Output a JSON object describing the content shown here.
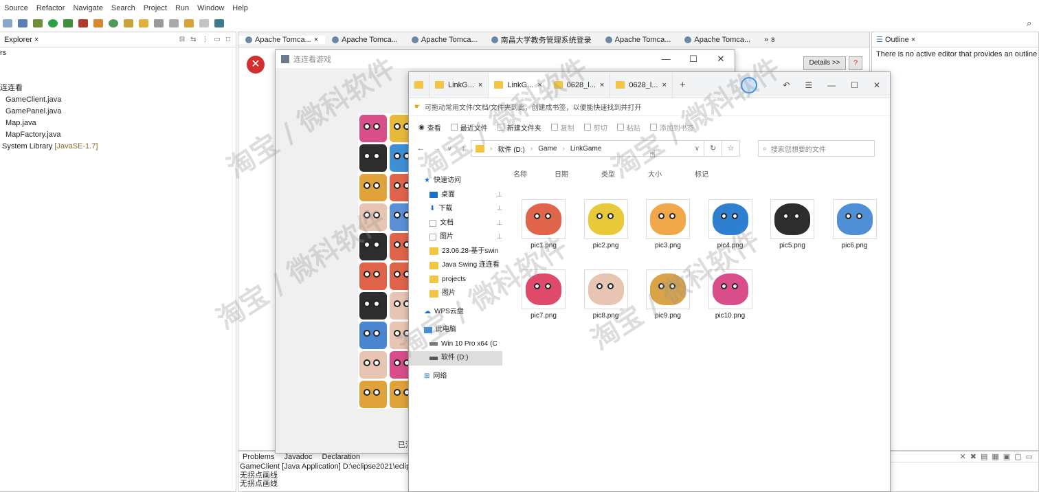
{
  "menu": [
    "Source",
    "Refactor",
    "Navigate",
    "Search",
    "Project",
    "Run",
    "Window",
    "Help"
  ],
  "explorer": {
    "title": "Explorer",
    "close": "×",
    "frag": "rs",
    "pkg": "连连看",
    "files": [
      "GameClient.java",
      "GamePanel.java",
      "Map.java",
      "MapFactory.java"
    ],
    "lib": "System Library",
    "lib_ver": "[JavaSE-1.7]"
  },
  "editor_tabs": [
    "Apache Tomca...",
    "Apache Tomca...",
    "Apache Tomca...",
    "南昌大学教务管理系统登录",
    "Apache Tomca...",
    "Apache Tomca..."
  ],
  "editor_overflow": "»",
  "editor_overflow_count": "8",
  "details_btn": "Details >>",
  "outline": {
    "title": "Outline",
    "message": "There is no active editor that provides an outline"
  },
  "console": {
    "tabs": [
      "Problems",
      "Javadoc",
      "Declaration"
    ],
    "header": "GameClient [Java Application] D:\\eclipse2021\\eclip",
    "lines": [
      "无拐点画线",
      "无拐点画线"
    ]
  },
  "game": {
    "title": "连连看游戏",
    "status": "已消"
  },
  "fileexplorer": {
    "tabs": [
      "LinkG...",
      "LinkG...",
      "0628_l...",
      "0628_l..."
    ],
    "add_tab": "+",
    "bookmark_hint": "可拖动常用文件/文档/文件夹到此，创建成书签，以便能快速找到并打开",
    "toolbar": [
      "查看",
      "最近文件",
      "新建文件夹",
      "复制",
      "剪切",
      "粘贴",
      "添加到书签"
    ],
    "path": [
      "软件 (D:)",
      "Game",
      "LinkGame"
    ],
    "search_placeholder": "搜索您想要的文件",
    "columns": [
      "名称",
      "日期",
      "类型",
      "大小",
      "标记"
    ],
    "nav": {
      "quick": "快速访问",
      "items": [
        "桌面",
        "下载",
        "文档",
        "图片",
        "23.06.28-基于swin",
        "Java Swing 连连看",
        "projects",
        "图片"
      ],
      "cloud": "WPS云盘",
      "pc": "此电脑",
      "drives": [
        "Win 10 Pro x64 (C",
        "软件 (D:)"
      ],
      "network": "网络"
    },
    "files": [
      "pic1.png",
      "pic2.png",
      "pic3.png",
      "pic4.png",
      "pic5.png",
      "pic6.png",
      "pic7.png",
      "pic8.png",
      "pic9.png",
      "pic10.png"
    ]
  },
  "watermark": "淘宝 / 微科软件",
  "colors": {
    "accent": "#1a6fd0",
    "folder": "#f4c542",
    "error": "#d32f2f"
  }
}
